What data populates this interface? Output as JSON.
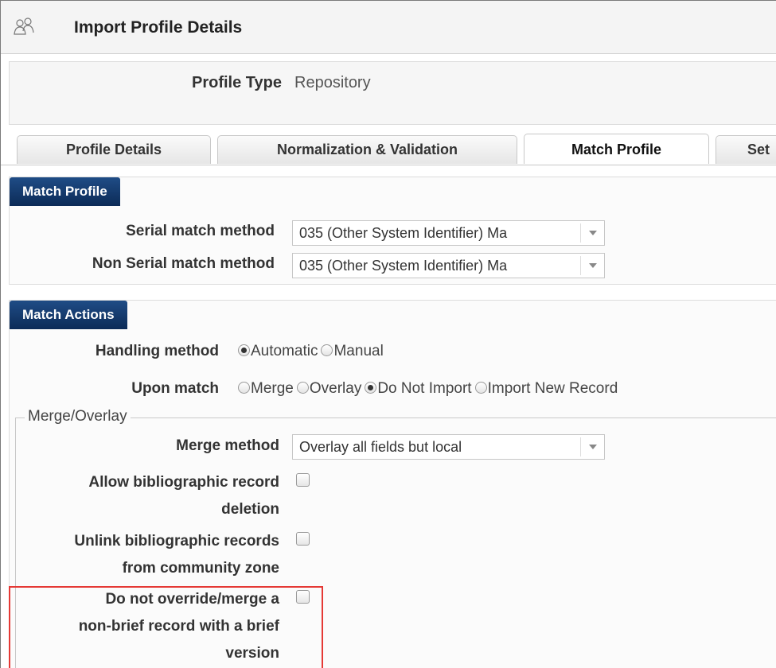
{
  "header": {
    "title": "Import Profile Details",
    "icon": "users-icon"
  },
  "profile": {
    "type_label": "Profile Type",
    "type_value": "Repository"
  },
  "tabs": [
    {
      "label": "Profile Details",
      "active": false
    },
    {
      "label": "Normalization & Validation",
      "active": false
    },
    {
      "label": "Match Profile",
      "active": true
    },
    {
      "label": "Set",
      "active": false
    }
  ],
  "match_profile": {
    "title": "Match Profile",
    "serial_label": "Serial match method",
    "serial_value": "035 (Other System Identifier) Ma",
    "non_serial_label": "Non Serial match method",
    "non_serial_value": "035 (Other System Identifier) Ma"
  },
  "match_actions": {
    "title": "Match Actions",
    "handling_label": "Handling method",
    "handling_options": [
      {
        "label": "Automatic",
        "selected": true
      },
      {
        "label": "Manual",
        "selected": false
      }
    ],
    "upon_label": "Upon match",
    "upon_options": [
      {
        "label": "Merge",
        "selected": false
      },
      {
        "label": "Overlay",
        "selected": false
      },
      {
        "label": "Do Not Import",
        "selected": true
      },
      {
        "label": "Import New Record",
        "selected": false
      }
    ],
    "merge_overlay": {
      "legend": "Merge/Overlay",
      "merge_method_label": "Merge method",
      "merge_method_value": "Overlay all fields but local",
      "allow_deletion_label_1": "Allow bibliographic record",
      "allow_deletion_label_2": "deletion",
      "unlink_label_1": "Unlink bibliographic records",
      "unlink_label_2": "from community zone",
      "no_override_label_1": "Do not override/merge a",
      "no_override_label_2": "non-brief record with a brief",
      "no_override_label_3": "version"
    }
  },
  "colors": {
    "section_header": "#16386b",
    "highlight": "#e53935"
  }
}
